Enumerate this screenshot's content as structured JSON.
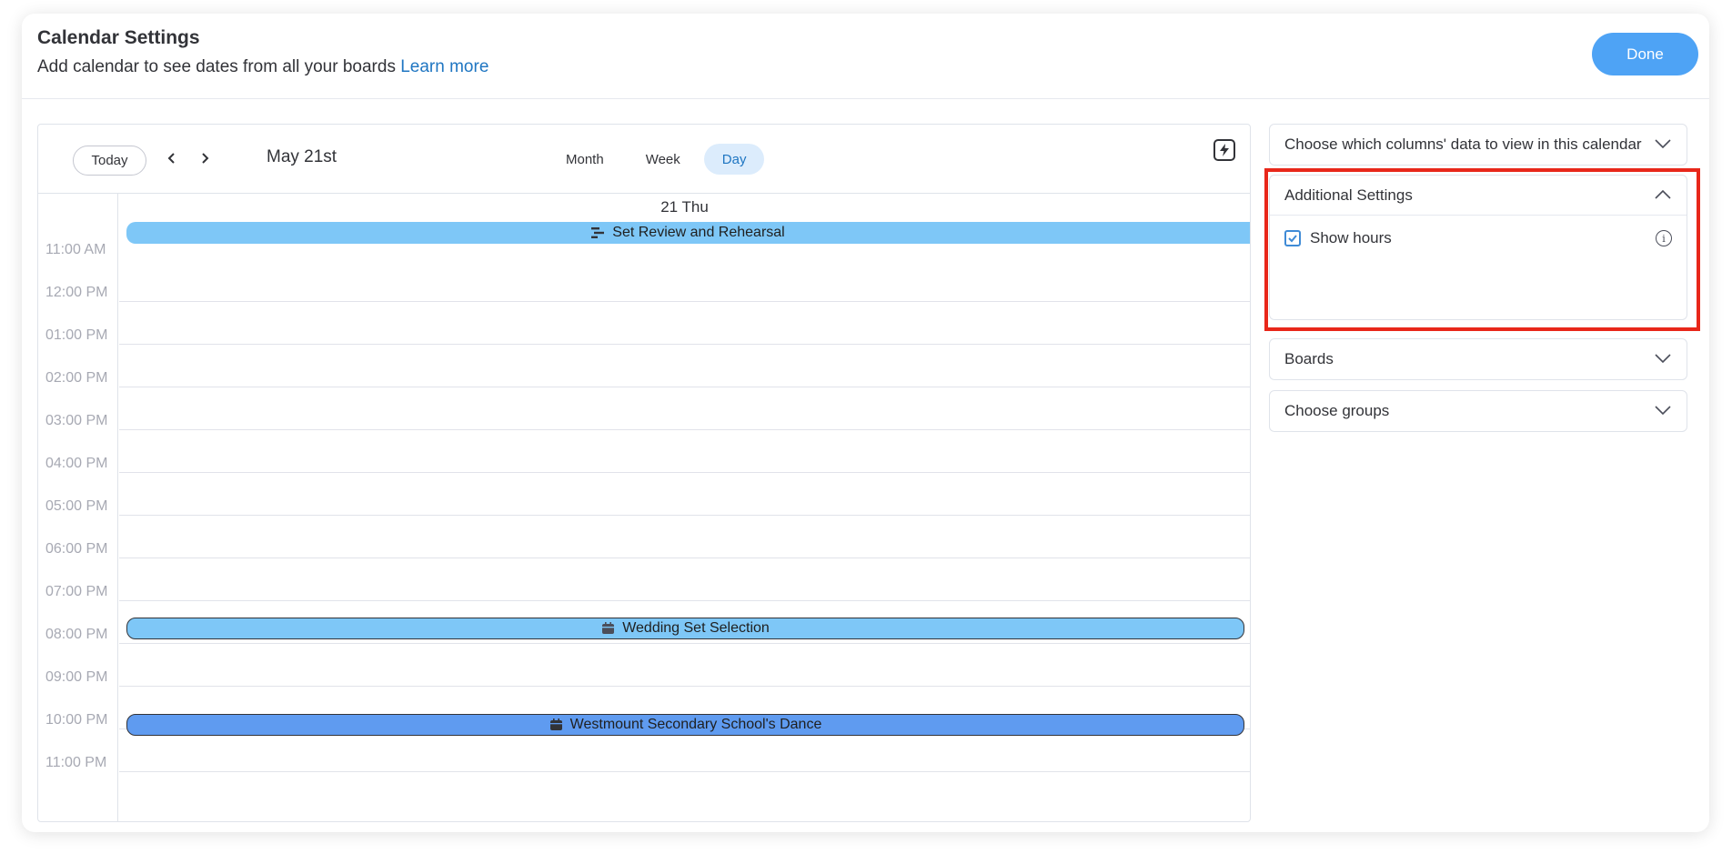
{
  "header": {
    "title": "Calendar Settings",
    "subtitle": "Add calendar to see dates from all your boards",
    "learn_more": "Learn more",
    "done_label": "Done"
  },
  "toolbar": {
    "today_label": "Today",
    "date_label": "May 21st",
    "views": [
      {
        "label": "Month",
        "active": false
      },
      {
        "label": "Week",
        "active": false
      },
      {
        "label": "Day",
        "active": true
      }
    ]
  },
  "day_view": {
    "day_header": "21 Thu",
    "hours": [
      "11:00 AM",
      "12:00 PM",
      "01:00 PM",
      "02:00 PM",
      "03:00 PM",
      "04:00 PM",
      "05:00 PM",
      "06:00 PM",
      "07:00 PM",
      "08:00 PM",
      "09:00 PM",
      "10:00 PM",
      "11:00 PM"
    ],
    "events": [
      {
        "title": "Set Review and Rehearsal",
        "icon": "timeline-icon",
        "color": "#7ec7f7",
        "all_day": true
      },
      {
        "title": "Wedding Set Selection",
        "icon": "calendar-icon",
        "color": "#7ec7f7",
        "time": "07:00 PM"
      },
      {
        "title": "Westmount Secondary School's Dance",
        "icon": "calendar-icon",
        "color": "#5f9bf0",
        "time": "09:00 PM"
      }
    ]
  },
  "settings_panels": {
    "columns": {
      "label": "Choose which columns' data to view in this calendar",
      "expanded": false
    },
    "additional": {
      "label": "Additional Settings",
      "expanded": true,
      "show_hours_label": "Show hours",
      "show_hours_checked": true
    },
    "boards": {
      "label": "Boards",
      "expanded": false
    },
    "groups": {
      "label": "Choose groups",
      "expanded": false
    }
  },
  "colors": {
    "accent": "#4ea3f5",
    "link": "#1f76c2",
    "highlight": "#e8271a"
  }
}
